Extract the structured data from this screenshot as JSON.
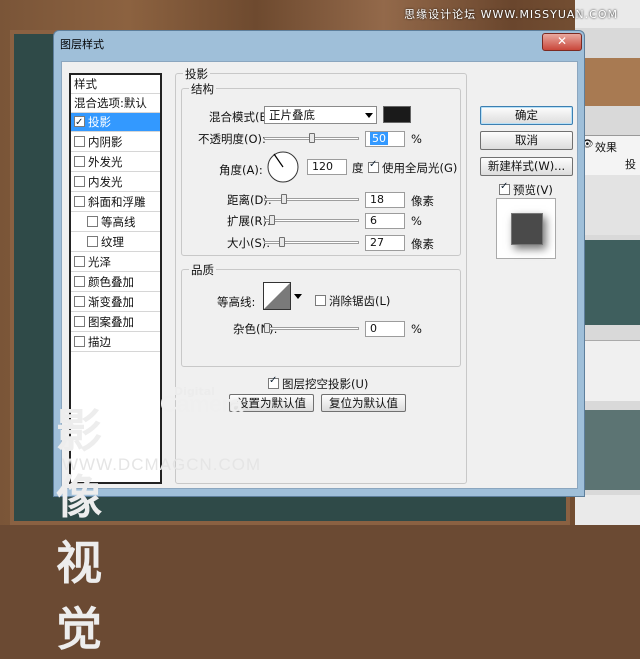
{
  "site_watermark": "思缘设计论坛 WWW.MISSYUAN.COM",
  "dialog": {
    "title": "图层样式",
    "close_label": "✕"
  },
  "style_list": {
    "header": "样式",
    "blend_options": "混合选项:默认",
    "items": [
      {
        "label": "投影",
        "checked": true,
        "selected": true
      },
      {
        "label": "内阴影",
        "checked": false
      },
      {
        "label": "外发光",
        "checked": false
      },
      {
        "label": "内发光",
        "checked": false
      },
      {
        "label": "斜面和浮雕",
        "checked": false
      },
      {
        "label": "等高线",
        "checked": false
      },
      {
        "label": "纹理",
        "checked": false
      },
      {
        "label": "光泽",
        "checked": false
      },
      {
        "label": "颜色叠加",
        "checked": false
      },
      {
        "label": "渐变叠加",
        "checked": false
      },
      {
        "label": "图案叠加",
        "checked": false
      },
      {
        "label": "描边",
        "checked": false
      }
    ]
  },
  "drop_shadow": {
    "section_title": "投影",
    "structure_title": "结构",
    "blend_mode_label": "混合模式(B):",
    "blend_mode_value": "正片叠底",
    "shadow_color": "#1a1a1a",
    "opacity_label": "不透明度(O):",
    "opacity_value": "50",
    "opacity_unit": "%",
    "angle_label": "角度(A):",
    "angle_value": "120",
    "angle_unit": "度",
    "global_light_label": "使用全局光(G)",
    "global_light_checked": true,
    "distance_label": "距离(D):",
    "distance_value": "18",
    "distance_unit": "像素",
    "spread_label": "扩展(R):",
    "spread_value": "6",
    "spread_unit": "%",
    "size_label": "大小(S):",
    "size_value": "27",
    "size_unit": "像素",
    "quality_title": "品质",
    "contour_label": "等高线:",
    "anti_alias_label": "消除锯齿(L)",
    "anti_alias_checked": false,
    "noise_label": "杂色(N):",
    "noise_value": "0",
    "noise_unit": "%",
    "knockout_label": "图层挖空投影(U)",
    "knockout_checked": true,
    "make_default_label": "设置为默认值",
    "reset_default_label": "复位为默认值"
  },
  "actions": {
    "ok_label": "确定",
    "cancel_label": "取消",
    "new_style_label": "新建样式(W)...",
    "preview_label": "预览(V)",
    "preview_checked": true
  },
  "background_panel": {
    "effects_label": "效果",
    "shadow_label": "投"
  },
  "brand_watermark": {
    "digital": "Digital",
    "camera": "Camera",
    "cn": "影像视觉",
    "url": "WWW.DCMAGCN.COM"
  }
}
